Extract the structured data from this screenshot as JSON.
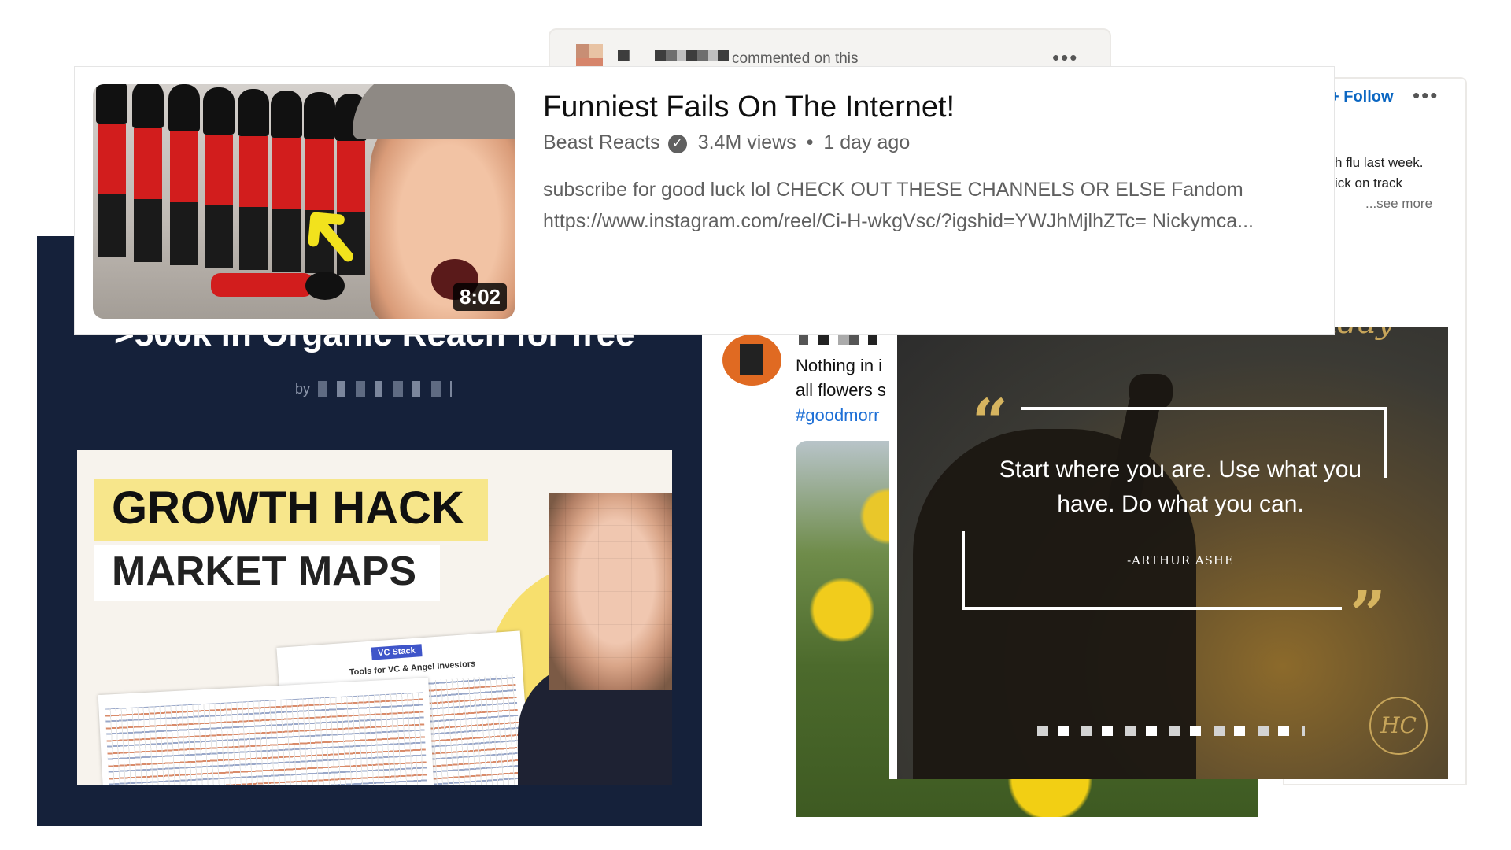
{
  "comment_card": {
    "text": "commented on this",
    "menu": "•••"
  },
  "right_card": {
    "follow": "+ Follow",
    "menu": "•••",
    "lines": [
      "h flu last week.",
      "ick on track"
    ],
    "see_more": "...see more"
  },
  "left_post": {
    "organic_title": ">500k in Organic Reach for free",
    "by": "by",
    "thumbnail": {
      "line1": "GROWTH HACK",
      "line2": "MARKET MAPS",
      "vc_stack": "VC Stack",
      "sheet_title": "Tools for VC & Angel Investors"
    }
  },
  "tweet": {
    "line1": "Nothing in i",
    "line2": "all flowers s",
    "hashtag": "#goodmorr"
  },
  "quote_card": {
    "heading": "Motivational Monday",
    "open_quote": "“",
    "close_quote": "”",
    "quote": "Start where you are. Use what you have. Do what you can.",
    "author": "-ARTHUR ASHE",
    "logo": "HC"
  },
  "youtube": {
    "title": "Funniest Fails On The Internet!",
    "channel": "Beast Reacts",
    "verified_icon": "check-circle-icon",
    "views": "3.4M views",
    "separator": "•",
    "age": "1 day ago",
    "description_line1": "subscribe for good luck lol CHECK OUT THESE CHANNELS OR ELSE Fandom",
    "description_line2": "https://www.instagram.com/reel/Ci-H-wkgVsc/?igshid=YWJhMjlhZTc= Nickymca...",
    "duration": "8:02"
  },
  "colors": {
    "link_blue": "#0a66c2",
    "hashtag_blue": "#1d6fd6",
    "navy": "#15213a",
    "gold": "#d6b45f",
    "growth_yellow": "#f7e68b"
  }
}
